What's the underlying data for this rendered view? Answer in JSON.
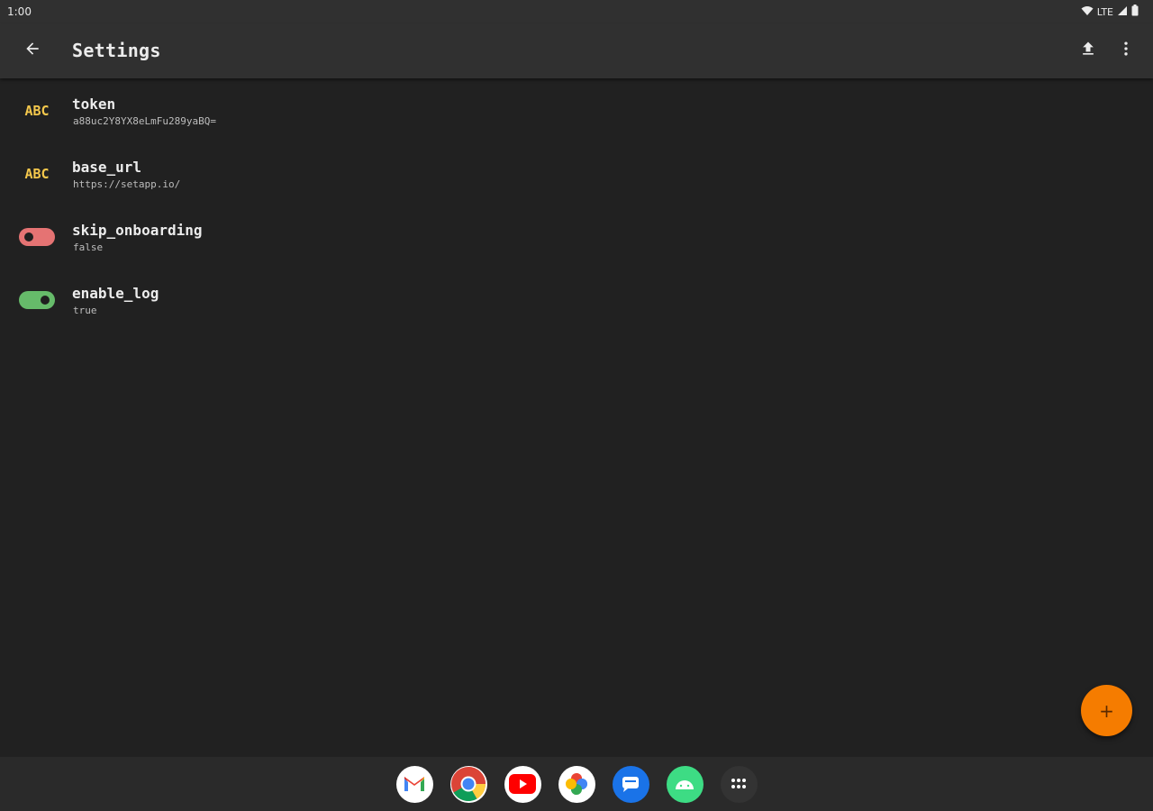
{
  "status_bar": {
    "time": "1:00",
    "network": "LTE"
  },
  "app_bar": {
    "title": "Settings",
    "icons": [
      "arrow-back-icon",
      "upload-icon",
      "more-vert-icon"
    ]
  },
  "settings": [
    {
      "key": "token",
      "value": "a88uc2Y8YX8eLmFu289yaBQ=",
      "type": "string",
      "icon": "abc-icon",
      "icon_label": "ABC"
    },
    {
      "key": "base_url",
      "value": "https://setapp.io/",
      "type": "string",
      "icon": "abc-icon",
      "icon_label": "ABC"
    },
    {
      "key": "skip_onboarding",
      "value": "false",
      "type": "boolean",
      "icon": "toggle-off-icon"
    },
    {
      "key": "enable_log",
      "value": "true",
      "type": "boolean",
      "icon": "toggle-on-icon"
    }
  ],
  "fab": {
    "icon": "plus-icon",
    "label": "+"
  },
  "dock": [
    "gmail-icon",
    "chrome-icon",
    "youtube-icon",
    "photos-icon",
    "messages-icon",
    "android-icon",
    "app-drawer-icon"
  ],
  "colors": {
    "background": "#212121",
    "app_bar": "#303030",
    "string_icon": "#f5c84c",
    "toggle_off": "#e57373",
    "toggle_on": "#66bb6a",
    "fab": "#f57c00"
  }
}
